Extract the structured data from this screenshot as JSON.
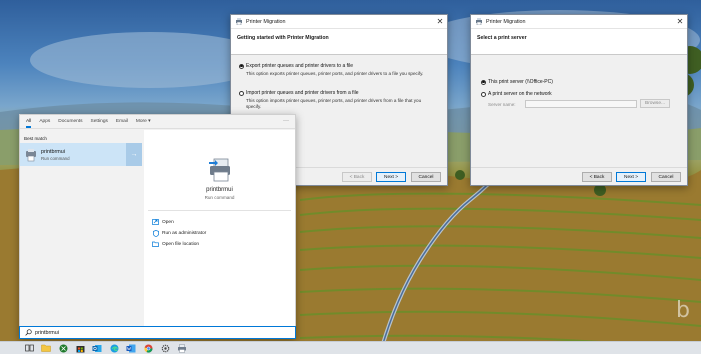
{
  "dialog1": {
    "title": "Printer Migration",
    "header": "Getting started with Printer Migration",
    "option1_label": "Export printer queues and printer drivers to a file",
    "option1_desc": "This option exports printer queues, printer ports, and printer drivers to a file you specify.",
    "option2_label": "Import printer queues and printer drivers from a file",
    "option2_desc": "This option imports printer queues, printer ports, and printer drivers from a file that you specify.",
    "back_label": "< Back",
    "next_label": "Next >",
    "cancel_label": "Cancel",
    "close_glyph": "✕"
  },
  "dialog2": {
    "title": "Printer Migration",
    "header": "Select a print server",
    "option1_label": "This print server (\\\\Office-PC)",
    "option2_label": "A print server on the network",
    "server_name_label": "Server name:",
    "server_name_value": "",
    "browse_label": "Browse...",
    "back_label": "< Back",
    "next_label": "Next >",
    "cancel_label": "Cancel",
    "close_glyph": "✕"
  },
  "search_panel": {
    "tabs": [
      "All",
      "Apps",
      "Documents",
      "Settings",
      "Email",
      "More ▾"
    ],
    "more_dots": "···",
    "best_match_label": "Best match",
    "result_name": "printbrmui",
    "result_sub": "Run command",
    "result_arrow": "→",
    "preview_name": "printbrmui",
    "preview_sub": "Run command",
    "actions": [
      "Open",
      "Run as administrator",
      "Open file location"
    ]
  },
  "search_box": {
    "value": "printbrmui"
  },
  "taskbar": {
    "items": [
      "task-view",
      "file-explorer",
      "xbox",
      "store",
      "outlook",
      "edge",
      "word",
      "chrome",
      "settings",
      "printer"
    ]
  },
  "watermark": "b",
  "colors": {
    "accent": "#0078d7",
    "selection": "#cce4f7"
  }
}
